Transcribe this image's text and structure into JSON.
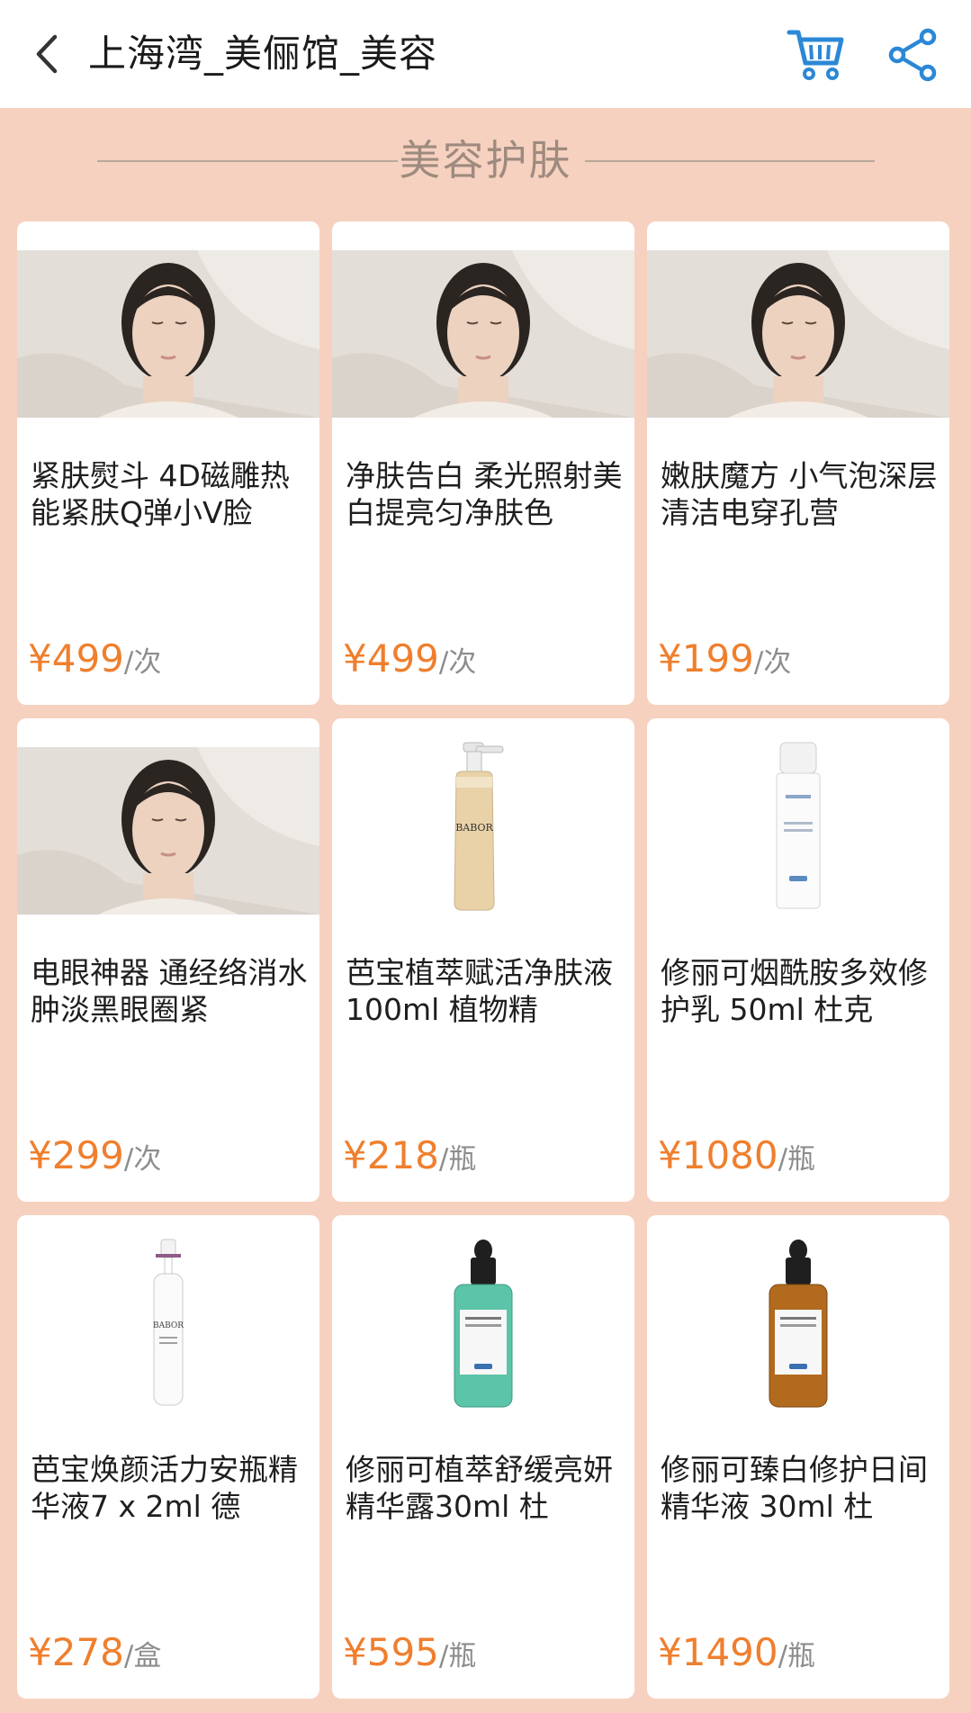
{
  "header": {
    "title": "上海湾_美俪馆_美容",
    "back_icon": "back-chevron-icon",
    "cart_icon": "cart-icon",
    "share_icon": "share-icon"
  },
  "section": {
    "title": "美容护肤"
  },
  "colors": {
    "page_bg": "#f6d1c0",
    "price": "#ef7f2e",
    "icon_blue": "#2b88d6"
  },
  "products": [
    {
      "name": "紧肤熨斗 4D磁雕热能紧肤Q弹小V脸",
      "price": "¥499",
      "unit": "/次",
      "image": "face-treatment-photo"
    },
    {
      "name": "净肤告白 柔光照射美白提亮匀净肤色",
      "price": "¥499",
      "unit": "/次",
      "image": "face-treatment-photo"
    },
    {
      "name": "嫩肤魔方 小气泡深层清洁电穿孔营",
      "price": "¥199",
      "unit": "/次",
      "image": "face-treatment-photo"
    },
    {
      "name": "电眼神器 通经络消水肿淡黑眼圈紧",
      "price": "¥299",
      "unit": "/次",
      "image": "face-treatment-photo"
    },
    {
      "name": "芭宝植萃赋活净肤液100ml 植物精",
      "price": "¥218",
      "unit": "/瓶",
      "image": "babor-pump-bottle",
      "bottle_label": "BABOR"
    },
    {
      "name": "修丽可烟酰胺多效修护乳 50ml 杜克",
      "price": "¥1080",
      "unit": "/瓶",
      "image": "skinceuticals-pump-bottle"
    },
    {
      "name": "芭宝焕颜活力安瓶精华液7 x 2ml 德",
      "price": "¥278",
      "unit": "/盒",
      "image": "babor-ampoule",
      "bottle_label": "BABOR"
    },
    {
      "name": "修丽可植萃舒缓亮妍精华露30ml 杜",
      "price": "¥595",
      "unit": "/瓶",
      "image": "green-dropper-bottle"
    },
    {
      "name": "修丽可臻白修护日间精华液 30ml 杜",
      "price": "¥1490",
      "unit": "/瓶",
      "image": "amber-dropper-bottle"
    }
  ]
}
